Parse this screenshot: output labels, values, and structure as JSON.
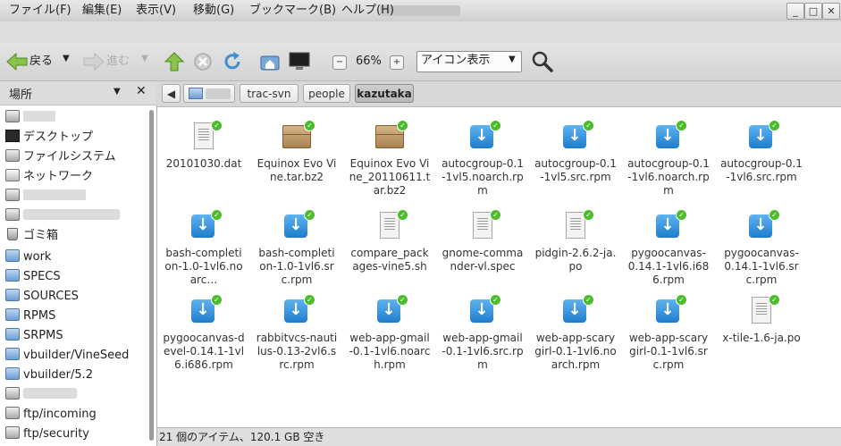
{
  "window": {
    "title": "",
    "controls": [
      "_",
      "□",
      "✕"
    ]
  },
  "menu": [
    {
      "label": "ファイル(F)"
    },
    {
      "label": "編集(E)"
    },
    {
      "label": "表示(V)"
    },
    {
      "label": "移動(G)"
    },
    {
      "label": "ブックマーク(B)"
    },
    {
      "label": "ヘルプ(H)"
    }
  ],
  "toolbar": {
    "back_label": "戻る",
    "forward_label": "進む",
    "zoom_level": "66%",
    "view_mode": "アイコン表示",
    "icons": [
      "back-arrow-icon",
      "forward-arrow-icon",
      "up-arrow-icon",
      "stop-icon",
      "reload-icon",
      "home-icon",
      "computer-icon",
      "zoom-out-icon",
      "zoom-in-icon",
      "search-icon"
    ]
  },
  "sidebar": {
    "title": "場所",
    "places": [
      {
        "label": "",
        "icon": "home-folder-icon",
        "blurred": true
      },
      {
        "label": "デスクトップ",
        "icon": "desktop-icon"
      },
      {
        "label": "ファイルシステム",
        "icon": "drive-icon"
      },
      {
        "label": "ネットワーク",
        "icon": "network-icon"
      },
      {
        "label": "",
        "icon": "drive-icon",
        "blurred": true
      },
      {
        "label": "",
        "icon": "drive-icon",
        "blurred": true
      },
      {
        "label": "ゴミ箱",
        "icon": "trash-icon"
      },
      {
        "label": "work",
        "icon": "folder-icon"
      },
      {
        "label": "SPECS",
        "icon": "folder-icon"
      },
      {
        "label": "SOURCES",
        "icon": "folder-icon"
      },
      {
        "label": "RPMS",
        "icon": "folder-icon"
      },
      {
        "label": "SRPMS",
        "icon": "folder-icon"
      },
      {
        "label": "vbuilder/VineSeed",
        "icon": "folder-icon"
      },
      {
        "label": "vbuilder/5.2",
        "icon": "folder-icon"
      },
      {
        "label": "",
        "icon": "network-folder-icon",
        "blurred": true
      },
      {
        "label": "ftp/incoming",
        "icon": "network-folder-icon"
      },
      {
        "label": "ftp/security",
        "icon": "network-folder-icon"
      }
    ]
  },
  "pathbar": {
    "crumbs": [
      "",
      "trac-svn",
      "people",
      "kazutaka"
    ],
    "active_index": 3
  },
  "files": [
    {
      "name": "20101030.dat",
      "icon": "text-file-icon"
    },
    {
      "name": "Equinox Evo Vine.tar.bz2",
      "icon": "archive-box-icon"
    },
    {
      "name": "Equinox Evo Vine_20110611.tar.bz2",
      "icon": "archive-box-icon"
    },
    {
      "name": "autocgroup-0.1-1vl5.noarch.rpm",
      "icon": "package-download-icon"
    },
    {
      "name": "autocgroup-0.1-1vl5.src.rpm",
      "icon": "package-download-icon"
    },
    {
      "name": "autocgroup-0.1-1vl6.noarch.rpm",
      "icon": "package-download-icon"
    },
    {
      "name": "autocgroup-0.1-1vl6.src.rpm",
      "icon": "package-download-icon"
    },
    {
      "name": "bash-completion-1.0-1vl6.noarc…",
      "icon": "package-download-icon"
    },
    {
      "name": "bash-completion-1.0-1vl6.src.rpm",
      "icon": "package-download-icon"
    },
    {
      "name": "compare_packages-vine5.sh",
      "icon": "text-file-icon"
    },
    {
      "name": "gnome-commander-vl.spec",
      "icon": "text-file-icon"
    },
    {
      "name": "pidgin-2.6.2-ja.po",
      "icon": "text-file-icon"
    },
    {
      "name": "pygoocanvas-0.14.1-1vl6.i686.rpm",
      "icon": "package-download-icon"
    },
    {
      "name": "pygoocanvas-0.14.1-1vl6.src.rpm",
      "icon": "package-download-icon"
    },
    {
      "name": "pygoocanvas-devel-0.14.1-1vl6.i686.rpm",
      "icon": "package-download-icon"
    },
    {
      "name": "rabbitvcs-nautilus-0.13-2vl6.src.rpm",
      "icon": "package-download-icon"
    },
    {
      "name": "web-app-gmail-0.1-1vl6.noarch.rpm",
      "icon": "package-download-icon"
    },
    {
      "name": "web-app-gmail-0.1-1vl6.src.rpm",
      "icon": "package-download-icon"
    },
    {
      "name": "web-app-scarygirl-0.1-1vl6.noarch.rpm",
      "icon": "package-download-icon"
    },
    {
      "name": "web-app-scarygirl-0.1-1vl6.src.rpm",
      "icon": "package-download-icon"
    },
    {
      "name": "x-tile-1.6-ja.po",
      "icon": "text-file-icon"
    }
  ],
  "status": {
    "text": "21 個のアイテム、120.1 GB 空き"
  },
  "colors": {
    "accent": "#1f7ccc",
    "badge": "#4cbb2c"
  }
}
